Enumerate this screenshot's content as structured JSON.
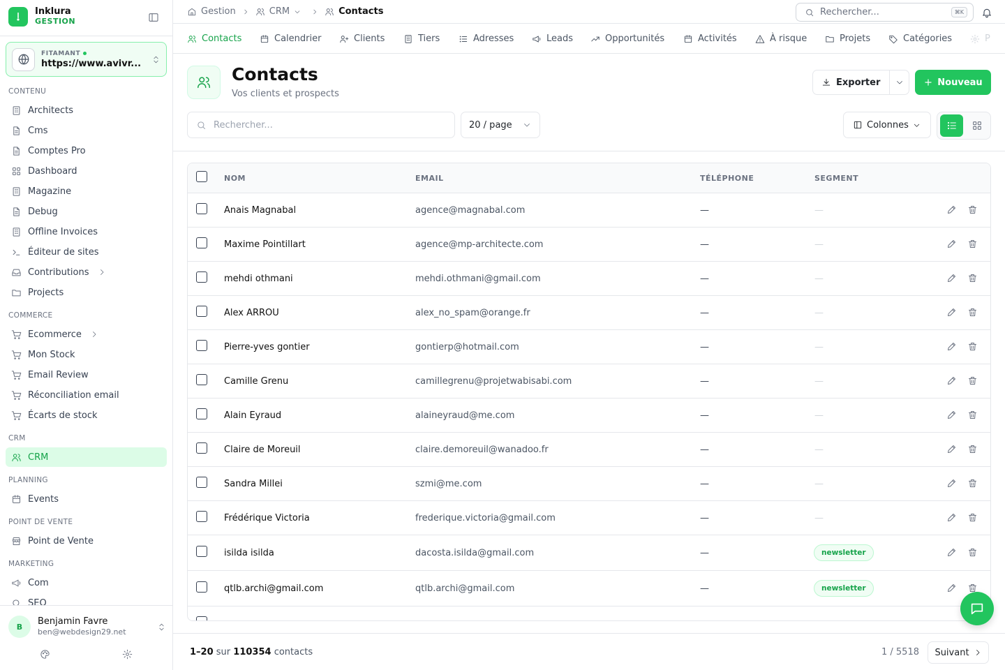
{
  "brand": {
    "name": "Inklura",
    "subtitle": "GESTION"
  },
  "site": {
    "label": "FITAMANT",
    "url": "https://www.avivr..."
  },
  "sidebar": {
    "sections": [
      {
        "title": "CONTENU",
        "items": [
          "Architects",
          "Cms",
          "Comptes Pro",
          "Dashboard",
          "Magazine",
          "Debug",
          "Offline Invoices",
          "Éditeur de sites",
          "Contributions",
          "Projects"
        ]
      },
      {
        "title": "COMMERCE",
        "items": [
          "Ecommerce",
          "Mon Stock",
          "Email Review",
          "Réconciliation email",
          "Écarts de stock"
        ]
      },
      {
        "title": "CRM",
        "items": [
          "CRM"
        ]
      },
      {
        "title": "PLANNING",
        "items": [
          "Events"
        ]
      },
      {
        "title": "POINT DE VENTE",
        "items": [
          "Point de Vente"
        ]
      },
      {
        "title": "MARKETING",
        "items": [
          "Com",
          "SEO"
        ]
      }
    ],
    "active_item": "CRM"
  },
  "user": {
    "initial": "B",
    "name": "Benjamin Favre",
    "email": "ben@webdesign29.net"
  },
  "breadcrumb": {
    "items": [
      "Gestion",
      "CRM",
      "Contacts"
    ]
  },
  "global_search": {
    "placeholder": "Rechercher...",
    "shortcut": "⌘K"
  },
  "tabs": [
    "Contacts",
    "Calendrier",
    "Clients",
    "Tiers",
    "Adresses",
    "Leads",
    "Opportunités",
    "Activités",
    "À risque",
    "Projets",
    "Catégories",
    "P"
  ],
  "active_tab": "Contacts",
  "page": {
    "title": "Contacts",
    "subtitle": "Vos clients et prospects"
  },
  "actions": {
    "export_label": "Exporter",
    "new_label": "Nouveau"
  },
  "filters": {
    "search_placeholder": "Rechercher...",
    "per_page": "20 / page",
    "columns_label": "Colonnes"
  },
  "table": {
    "headers": {
      "name": "NOM",
      "email": "EMAIL",
      "phone": "TÉLÉPHONE",
      "segment": "SEGMENT"
    },
    "rows": [
      {
        "name": "Anais Magnabal",
        "email": "agence@magnabal.com",
        "phone": "—",
        "segment": "—"
      },
      {
        "name": "Maxime Pointillart",
        "email": "agence@mp-architecte.com",
        "phone": "—",
        "segment": "—"
      },
      {
        "name": "mehdi othmani",
        "email": "mehdi.othmani@gmail.com",
        "phone": "—",
        "segment": "—"
      },
      {
        "name": "Alex ARROU",
        "email": "alex_no_spam@orange.fr",
        "phone": "—",
        "segment": "—"
      },
      {
        "name": "Pierre-yves gontier",
        "email": "gontierp@hotmail.com",
        "phone": "—",
        "segment": "—"
      },
      {
        "name": "Camille Grenu",
        "email": "camillegrenu@projetwabisabi.com",
        "phone": "—",
        "segment": "—"
      },
      {
        "name": "Alain Eyraud",
        "email": "alaineyraud@me.com",
        "phone": "—",
        "segment": "—"
      },
      {
        "name": "Claire de Moreuil",
        "email": "claire.demoreuil@wanadoo.fr",
        "phone": "—",
        "segment": "—"
      },
      {
        "name": "Sandra Millei",
        "email": "szmi@me.com",
        "phone": "—",
        "segment": "—"
      },
      {
        "name": "Frédérique Victoria",
        "email": "frederique.victoria@gmail.com",
        "phone": "—",
        "segment": "—"
      },
      {
        "name": "isilda isilda",
        "email": "dacosta.isilda@gmail.com",
        "phone": "—",
        "segment": "newsletter"
      },
      {
        "name": "qtlb.archi@gmail.com",
        "email": "qtlb.archi@gmail.com",
        "phone": "—",
        "segment": "newsletter"
      }
    ]
  },
  "pagination": {
    "range": "1–20",
    "sur": "sur",
    "total": "110354",
    "unit": "contacts",
    "page_info": "1 / 5518",
    "next_label": "Suivant"
  },
  "colors": {
    "accent": "#22c55e",
    "accent_dark": "#16a34a",
    "accent_light": "#dcfce7"
  }
}
